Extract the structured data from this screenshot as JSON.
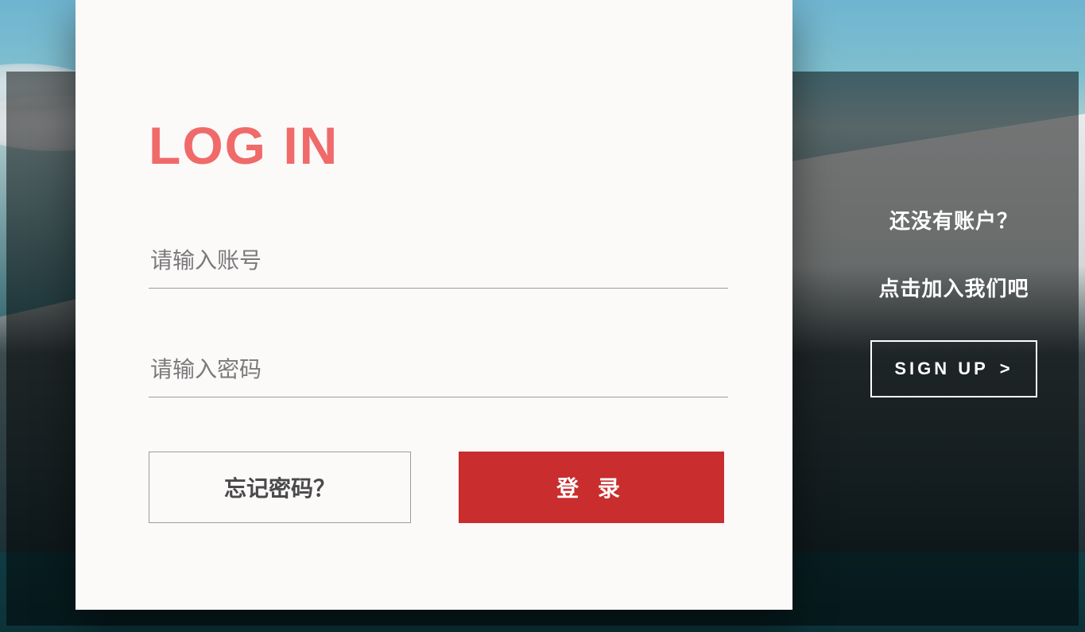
{
  "login": {
    "title": "LOG IN",
    "username_placeholder": "请输入账号",
    "password_placeholder": "请输入密码",
    "forgot_label": "忘记密码？",
    "submit_label": "登 录"
  },
  "side": {
    "line1": "还没有账户？",
    "line2": "点击加入我们吧",
    "signup_label": "SIGN UP",
    "signup_arrow": ">"
  }
}
